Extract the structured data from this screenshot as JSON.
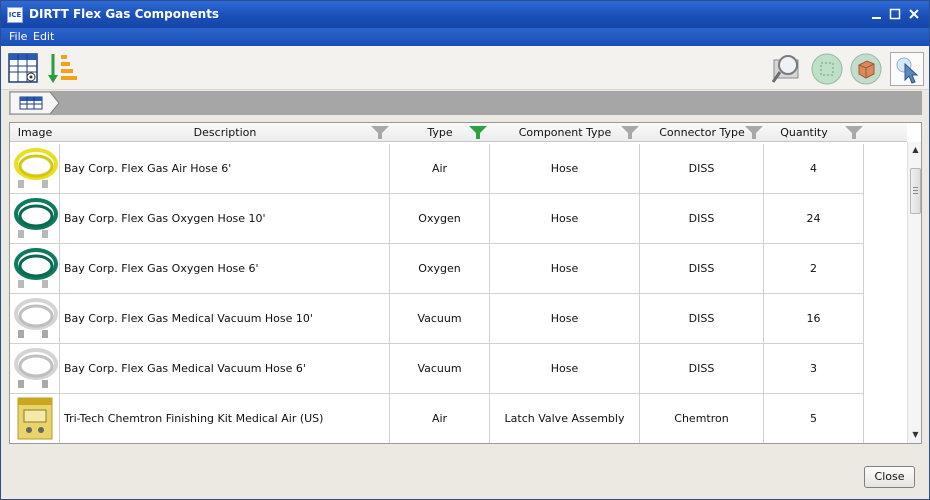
{
  "window": {
    "title": "DIRTT Flex Gas Components",
    "app_icon_text": "ICE"
  },
  "menu": {
    "items": [
      "File",
      "Edit"
    ]
  },
  "toolbar": {
    "left": [
      "table-view-icon",
      "sort-order-icon"
    ],
    "right": [
      "zoom-search-icon",
      "select-area-icon",
      "3d-box-icon",
      "pointer-select-icon"
    ]
  },
  "table": {
    "columns": [
      "Image",
      "Description",
      "Type",
      "Component Type",
      "Connector Type",
      "Quantity"
    ],
    "filter_active_column": "Type",
    "rows": [
      {
        "image": "yellow-hose-image",
        "description": "Bay Corp. Flex Gas Air Hose 6'",
        "type": "Air",
        "component_type": "Hose",
        "connector_type": "DISS",
        "quantity": "4"
      },
      {
        "image": "green-hose-image",
        "description": "Bay Corp. Flex Gas Oxygen Hose 10'",
        "type": "Oxygen",
        "component_type": "Hose",
        "connector_type": "DISS",
        "quantity": "24"
      },
      {
        "image": "green-hose-image",
        "description": "Bay Corp. Flex Gas Oxygen Hose 6'",
        "type": "Oxygen",
        "component_type": "Hose",
        "connector_type": "DISS",
        "quantity": "2"
      },
      {
        "image": "white-hose-image",
        "description": "Bay Corp. Flex Gas Medical Vacuum Hose 10'",
        "type": "Vacuum",
        "component_type": "Hose",
        "connector_type": "DISS",
        "quantity": "16"
      },
      {
        "image": "white-hose-image",
        "description": "Bay Corp. Flex Gas Medical Vacuum Hose 6'",
        "type": "Vacuum",
        "component_type": "Hose",
        "connector_type": "DISS",
        "quantity": "3"
      },
      {
        "image": "medical-air-kit-image",
        "description": "Tri-Tech Chemtron Finishing Kit Medical Air (US)",
        "type": "Air",
        "component_type": "Latch Valve Assembly",
        "connector_type": "Chemtron",
        "quantity": "5"
      }
    ]
  },
  "footer": {
    "close_label": "Close"
  },
  "colors": {
    "title_bar": "#1a4fb8",
    "filter_active": "#2fa344",
    "filter_inactive": "#a8a8a8"
  }
}
